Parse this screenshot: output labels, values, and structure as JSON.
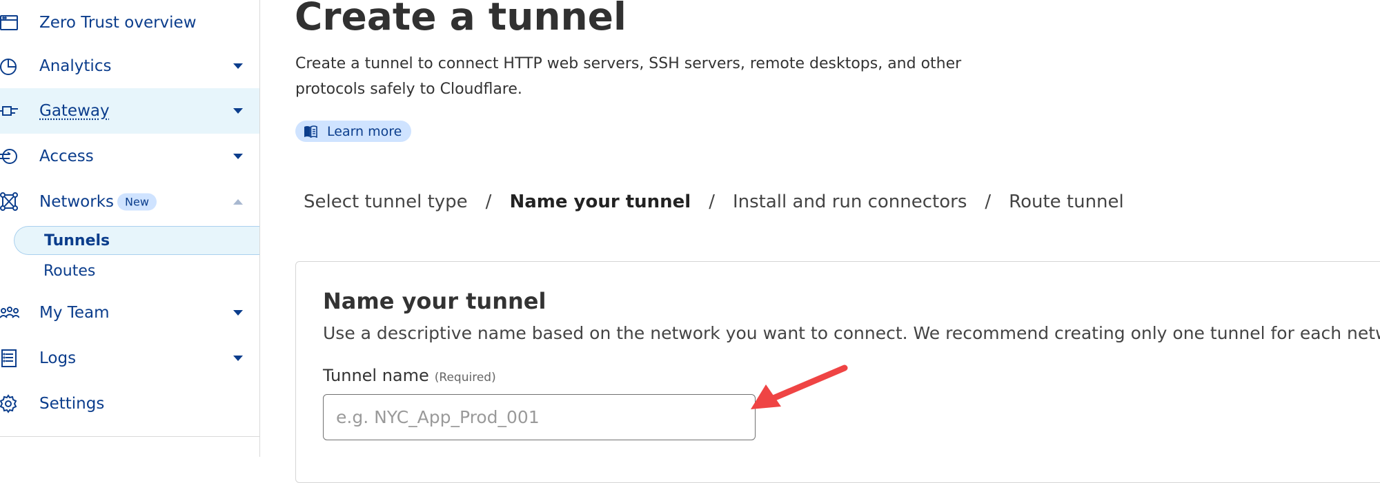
{
  "sidebar": {
    "items": [
      {
        "label": "Zero Trust overview",
        "icon": "window-icon"
      },
      {
        "label": "Analytics",
        "icon": "pie-chart-icon"
      },
      {
        "label": "Gateway",
        "icon": "gateway-icon"
      },
      {
        "label": "Access",
        "icon": "access-icon"
      },
      {
        "label": "Networks",
        "icon": "network-icon",
        "badge": "New"
      },
      {
        "label": "My Team",
        "icon": "team-icon"
      },
      {
        "label": "Logs",
        "icon": "logs-icon"
      },
      {
        "label": "Settings",
        "icon": "gear-icon"
      }
    ],
    "subitems": [
      {
        "label": "Tunnels"
      },
      {
        "label": "Routes"
      }
    ]
  },
  "main": {
    "title": "Create a tunnel",
    "description": "Create a tunnel to connect HTTP web servers, SSH servers, remote desktops, and other protocols safely to Cloudflare.",
    "learn_more": "Learn more",
    "breadcrumb": {
      "steps": [
        "Select tunnel type",
        "Name your tunnel",
        "Install and run connectors",
        "Route tunnel"
      ],
      "separator": "/"
    },
    "card": {
      "title": "Name your tunnel",
      "description": "Use a descriptive name based on the network you want to connect. We recommend creating only one tunnel for each network.",
      "field_label": "Tunnel name",
      "field_required": "(Required)",
      "input_value": "",
      "input_placeholder": "e.g. NYC_App_Prod_001"
    }
  },
  "colors": {
    "nav_text": "#0b3d8c",
    "active_bg": "#e7f5fb",
    "badge_bg": "#cfe3ff",
    "annotation_arrow": "#ef4444"
  }
}
